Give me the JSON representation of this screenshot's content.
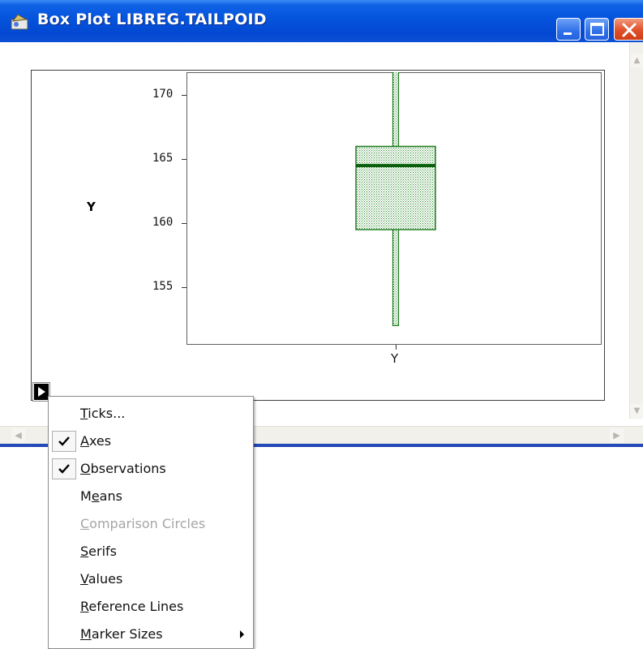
{
  "window": {
    "title": "Box Plot LIBREG.TAILPOID",
    "title_icon": "sas-graph-icon"
  },
  "plot": {
    "y_variable_label": "Y",
    "x_category_label": "Y",
    "y_ticks": [
      "170",
      "165",
      "160",
      "155"
    ],
    "colors": {
      "box": "#1f7a1f",
      "median": "#0b5e0b",
      "frame": "#404040"
    }
  },
  "chart_data": {
    "type": "box",
    "categories": [
      "Y"
    ],
    "ylabel": "Y",
    "xlabel": "Y",
    "ylim": [
      150.5,
      171.8
    ],
    "y_ticks": [
      155,
      160,
      165,
      170
    ],
    "boxes": [
      {
        "category": "Y",
        "min": 152.0,
        "q1": 159.5,
        "median": 164.5,
        "q3": 166.0,
        "max": 172.0
      }
    ]
  },
  "context_menu": {
    "items": [
      {
        "label_parts": [
          "",
          "T",
          "icks..."
        ],
        "checked": false,
        "disabled": false,
        "submenu": false
      },
      {
        "label_parts": [
          "",
          "A",
          "xes"
        ],
        "checked": true,
        "disabled": false,
        "submenu": false
      },
      {
        "label_parts": [
          "",
          "O",
          "bservations"
        ],
        "checked": true,
        "disabled": false,
        "submenu": false
      },
      {
        "label_parts": [
          "M",
          "e",
          "ans"
        ],
        "checked": false,
        "disabled": false,
        "submenu": false
      },
      {
        "label_parts": [
          "",
          "C",
          "omparison Circles"
        ],
        "checked": false,
        "disabled": true,
        "submenu": false
      },
      {
        "label_parts": [
          "",
          "S",
          "erifs"
        ],
        "checked": false,
        "disabled": false,
        "submenu": false
      },
      {
        "label_parts": [
          "",
          "V",
          "alues"
        ],
        "checked": false,
        "disabled": false,
        "submenu": false
      },
      {
        "label_parts": [
          "",
          "R",
          "eference Lines"
        ],
        "checked": false,
        "disabled": false,
        "submenu": false
      },
      {
        "label_parts": [
          "",
          "M",
          "arker Sizes"
        ],
        "checked": false,
        "disabled": false,
        "submenu": true
      }
    ]
  }
}
